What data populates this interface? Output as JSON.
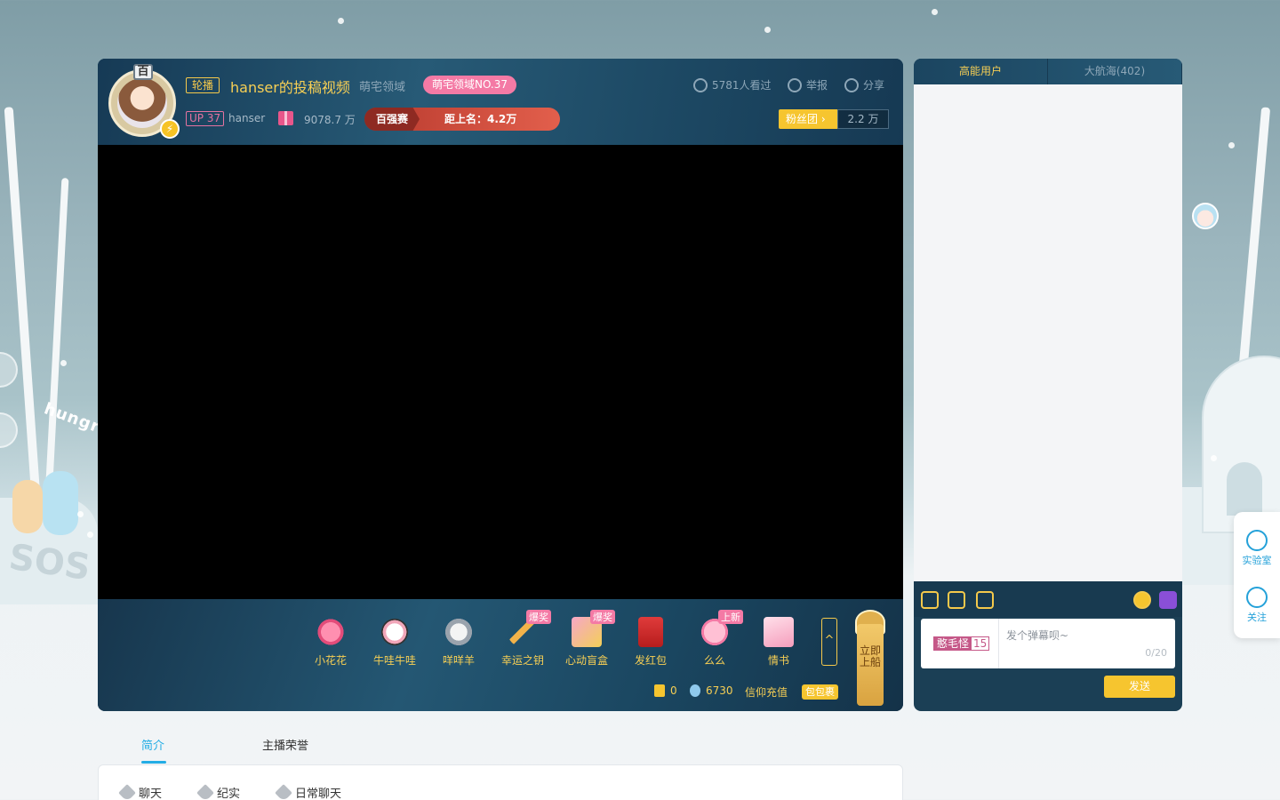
{
  "room": {
    "avatar_text": "百",
    "rebroadcast_tag": "轮播",
    "title": "hanser的投稿视频",
    "area": "萌宅领域",
    "area_rank": "萌宅领域NO.37",
    "viewers": "5781人看过",
    "report": "举报",
    "share": "分享",
    "up_level": "UP 37",
    "host_name": "hanser",
    "gift_value": "9078.7 万",
    "race_label": "百强赛",
    "race_gap": "距上名：4.2万",
    "fan_club": "粉丝团",
    "fan_count": "2.2 万"
  },
  "gifts": [
    {
      "name": "小花花",
      "icon": "flower-icon",
      "badge": ""
    },
    {
      "name": "牛哇牛哇",
      "icon": "cow-icon",
      "badge": ""
    },
    {
      "name": "咩咩羊",
      "icon": "sheep-icon",
      "badge": ""
    },
    {
      "name": "幸运之钥",
      "icon": "key-icon",
      "badge": "爆奖"
    },
    {
      "name": "心动盲盒",
      "icon": "blindbox-icon",
      "badge": "爆奖"
    },
    {
      "name": "发红包",
      "icon": "red-envelope-icon",
      "badge": ""
    },
    {
      "name": "么么",
      "icon": "heart-kiss-icon",
      "badge": "上新"
    },
    {
      "name": "情书",
      "icon": "love-letter-icon",
      "badge": ""
    }
  ],
  "gift_bar": {
    "expand": "^",
    "board_label": "立即上船",
    "battery": "0",
    "gold": "6730",
    "recharge": "信仰充值",
    "pack": "包包裹"
  },
  "panel": {
    "tabs": [
      "高能用户",
      "大航海(402)"
    ],
    "medal_name": "憨毛怪",
    "medal_level": "15",
    "input_placeholder": "发个弹幕呗~",
    "input_count": "0/20",
    "send": "发送"
  },
  "side": {
    "lab": "实验室",
    "follow": "关注"
  },
  "below": {
    "tabs": [
      "简介",
      "主播荣誉"
    ],
    "tags": [
      "聊天",
      "纪实",
      "日常聊天"
    ]
  },
  "decor": {
    "hungry": "hungry",
    "sos": "SOS"
  },
  "colors": {
    "accent_gold": "#f7cf54",
    "pink": "#f47aa5",
    "blue": "#23ade5"
  }
}
